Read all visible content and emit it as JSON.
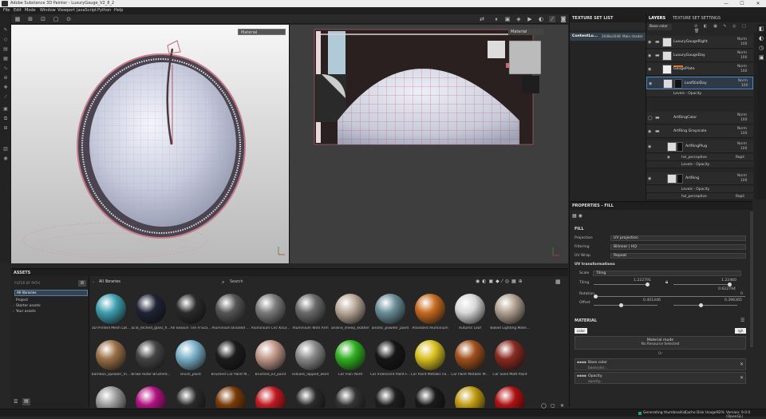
{
  "app": {
    "title": "Adobe Substance 3D Painter - LuxuryGauge_V2_8_2"
  },
  "window_controls": [
    "—",
    "☐",
    "✕"
  ],
  "menu": [
    "File",
    "Edit",
    "Mode",
    "Window",
    "Viewport",
    "JavaScript",
    "Python",
    "Help"
  ],
  "viewport": {
    "material_select": "Material",
    "material_select_2d": "Material"
  },
  "texture_set_list": {
    "title": "TEXTURE SET LIST",
    "items": [
      {
        "name": "ContentLu...",
        "res": "2048x2048",
        "shader": "Main shader"
      }
    ]
  },
  "layers": {
    "tabs": [
      "LAYERS",
      "TEXTURE SET SETTINGS"
    ],
    "channel": "Base color",
    "rows": [
      {
        "name": "LuxuryGaugeRight",
        "blend": "Norm",
        "opacity": "100"
      },
      {
        "name": "LuxuryGaugeDay",
        "blend": "Norm",
        "opacity": "100"
      },
      {
        "name": "GaugePlate",
        "blend": "Norm",
        "opacity": "100"
      },
      {
        "name": "LeafDialDay",
        "blend": "Norm",
        "opacity": "100"
      },
      {
        "name": "ArtRingColor",
        "blend": "Norm",
        "opacity": "100"
      },
      {
        "name": "ArtRing Grayscale",
        "blend": "Norm",
        "opacity": "100"
      },
      {
        "name": "ArtRingPlug",
        "blend": "Norm",
        "opacity": "100"
      },
      {
        "name": "ArtRing",
        "blend": "Norm",
        "opacity": "100"
      },
      {
        "name": "PointerDay",
        "blend": "Norm",
        "opacity": "100"
      }
    ],
    "subrows": {
      "levels_opacity": "Levels - Opacity",
      "hsl": "hsl_perceptive",
      "repl": "Repli",
      "levels": "Levels - Opacity",
      "val100": "100"
    }
  },
  "properties": {
    "title": "PROPERTIES - FILL",
    "fill_label": "FILL",
    "projection": {
      "label": "Projection",
      "value": "UV projection"
    },
    "filtering": {
      "label": "Filtering",
      "value": "Bilinear | HQ"
    },
    "uv_wrap": {
      "label": "UV Wrap",
      "value": "Repeat"
    },
    "uv_transformations": "UV transformations",
    "scale": {
      "label": "Scale",
      "value": "Tiling"
    },
    "tiling": {
      "label": "Tiling",
      "v1": "1.222791",
      "v2": "1.22460",
      "v3": "0.622794"
    },
    "rotation": {
      "label": "Rotation",
      "value": "0"
    },
    "offset": {
      "label": "Offset",
      "v1": "0.401446",
      "v2": "0.396365"
    },
    "material": {
      "title": "MATERIAL",
      "btn_left": "color",
      "btn_right": "rgh",
      "mode": "Material mode",
      "mode_sub": "No Resource Selected",
      "or": "Or",
      "base_color": {
        "label": "Base color",
        "sub": "basecolor..."
      },
      "opacity": {
        "label": "Opacity",
        "sub": "opacity..."
      }
    }
  },
  "assets": {
    "title": "ASSETS",
    "filter_label": "FILTER BY PATH",
    "tree": [
      "All libraries",
      "Project",
      "Starter assets",
      "Your assets"
    ],
    "breadcrumb": "All libraries",
    "search_placeholder": "Search",
    "items": [
      {
        "name": "3D Printed Mesh Lat...",
        "color": "#3e9fb0"
      },
      {
        "name": "acid_etched_glass_fl...",
        "color": "#1f2435"
      },
      {
        "name": "All Season Tire H Sca...",
        "color": "#2b2b2b"
      },
      {
        "name": "Aluminium Braided ...",
        "color": "#555555"
      },
      {
        "name": "Aluminium Circ Knur...",
        "color": "#7a7a7a"
      },
      {
        "name": "Aluminium Wire Arm",
        "color": "#6a6a6a"
      },
      {
        "name": "aniline_sheep_leather",
        "color": "#b8a898"
      },
      {
        "name": "anodic_powder_paint",
        "color": "#6a8e98"
      },
      {
        "name": "Anodized Aluminium",
        "color": "#c66a1f"
      },
      {
        "name": "Autumn Leaf",
        "color": "#d8d8d8"
      },
      {
        "name": "Baked Lighting Mate...",
        "color": "#b0a090"
      },
      {
        "name": "bamboo_speaker_m...",
        "color": "#9a7048"
      },
      {
        "name": "Brake Rotor Brushed...",
        "color": "#444444"
      },
      {
        "name": "brush_paint",
        "color": "#7ab0c8"
      },
      {
        "name": "Brushed Car Paint M...",
        "color": "#1c1c1c"
      },
      {
        "name": "brushed_oil_paint",
        "color": "#c09888"
      },
      {
        "name": "cellules_lapped_worn",
        "color": "#8a8a8a"
      },
      {
        "name": "Car Flan Paint",
        "color": "#30b020"
      },
      {
        "name": "Car Iridescent Paint F...",
        "color": "#161616"
      },
      {
        "name": "Car Paint Metallic Fa...",
        "color": "#d8c020"
      },
      {
        "name": "Car Paint Metallic M...",
        "color": "#a0501c"
      },
      {
        "name": "Car Solid Matt Paint",
        "color": "#8a2a22"
      },
      {
        "name": "",
        "color": "#9a9a9a"
      },
      {
        "name": "",
        "color": "#b01080"
      },
      {
        "name": "",
        "color": "#2a2a2a"
      },
      {
        "name": "",
        "color": "#7a3a08"
      },
      {
        "name": "",
        "color": "#c01820"
      },
      {
        "name": "",
        "color": "#2a2a2a"
      },
      {
        "name": "",
        "color": "#333333"
      },
      {
        "name": "",
        "color": "#1e1e1e"
      },
      {
        "name": "",
        "color": "#1a1a1a"
      },
      {
        "name": "",
        "color": "#c09a10"
      },
      {
        "name": "",
        "color": "#b01010"
      }
    ]
  },
  "status": {
    "generating": "Generating thumbnail(s)...",
    "cache": "Cache Disk Usage:",
    "cache_val": "92%",
    "version": "Version: 9.0.0 (OpenGL)"
  }
}
